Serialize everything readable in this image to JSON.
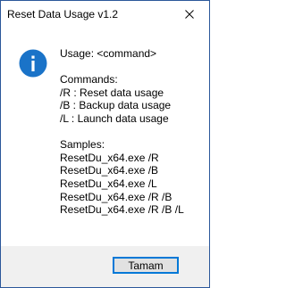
{
  "window": {
    "title": "Reset Data Usage v1.2",
    "close_icon": "close-icon"
  },
  "message": {
    "icon": "info-icon",
    "usage": "Usage: <command>",
    "commands_header": "Commands:",
    "commands": [
      "/R : Reset data usage",
      "/B : Backup data usage",
      "/L : Launch data usage"
    ],
    "samples_header": "Samples:",
    "samples": [
      "ResetDu_x64.exe /R",
      "ResetDu_x64.exe /B",
      "ResetDu_x64.exe /L",
      "ResetDu_x64.exe /R /B",
      "ResetDu_x64.exe /R /B /L"
    ]
  },
  "buttons": {
    "ok_label": "Tamam"
  },
  "colors": {
    "accent": "#0078d7",
    "info_icon": "#1a73c8",
    "border": "#2b579a",
    "footer_bg": "#f0f0f0"
  }
}
